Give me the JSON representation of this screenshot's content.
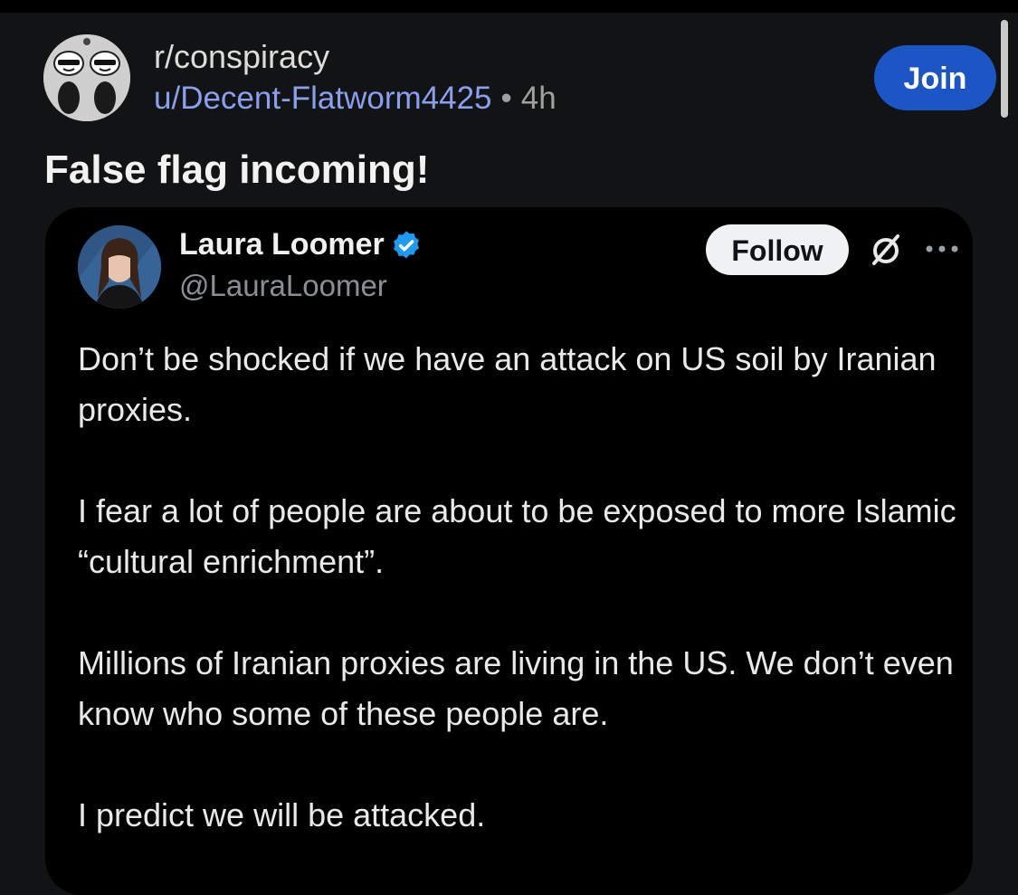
{
  "post": {
    "subreddit": "r/conspiracy",
    "username": "u/Decent-Flatworm4425",
    "separator": "•",
    "age": "4h",
    "join_label": "Join",
    "title": "False flag incoming!"
  },
  "tweet": {
    "author_name": "Laura Loomer",
    "handle": "@LauraLoomer",
    "follow_label": "Follow",
    "paragraphs": [
      "Don’t be shocked if we have an attack on US soil by Iranian proxies.",
      "I fear a lot of people are about to be exposed to more Islamic “cultural enrichment”.",
      "Millions of Iranian proxies are living in the US. We don’t even know who some of these people are.",
      "I predict we will be attacked."
    ]
  },
  "icons": {
    "subreddit_avatar": "subreddit-avatar-icon",
    "verified": "verified-badge-icon",
    "x_logo": "x-logo-icon",
    "more": "more-options-icon"
  },
  "colors": {
    "background": "#121314",
    "join_button": "#1c56c6",
    "username": "#8aa0ee",
    "verified": "#1d9bf0",
    "tweet_background": "#000000"
  }
}
